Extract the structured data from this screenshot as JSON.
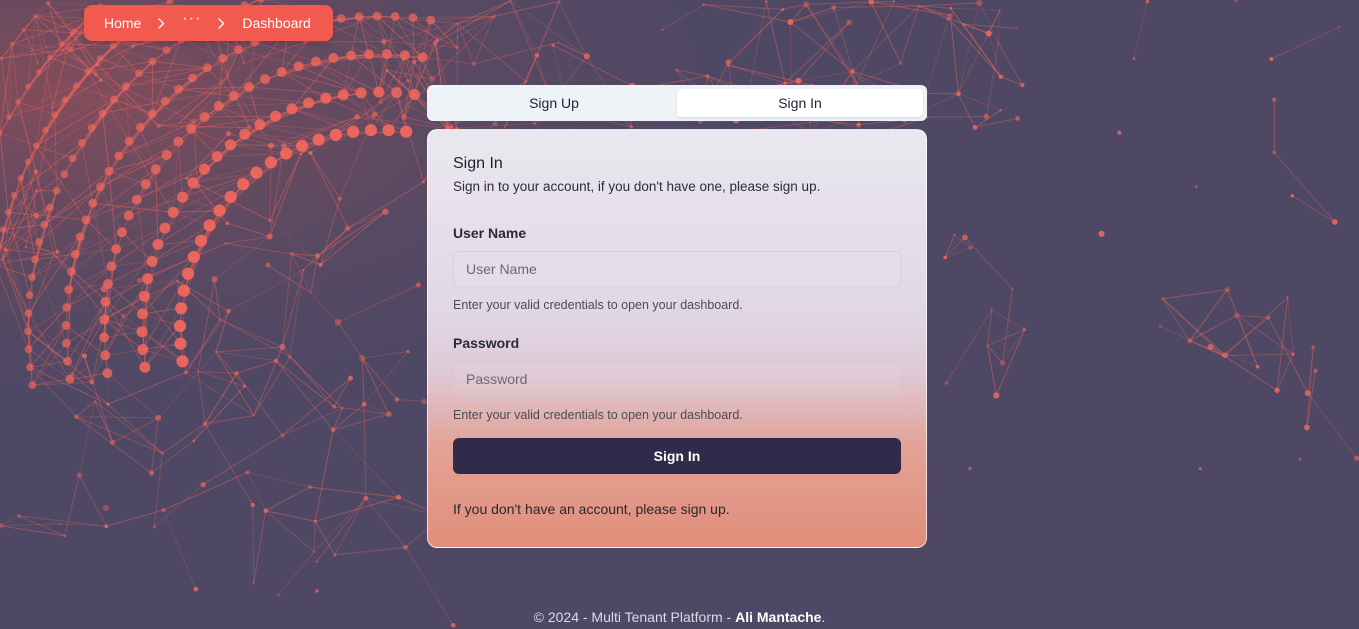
{
  "breadcrumb": {
    "home": "Home",
    "ellipsis": "···",
    "current": "Dashboard",
    "color": "#f2594f"
  },
  "tabs": {
    "sign_up": "Sign Up",
    "sign_in": "Sign In",
    "active": "sign_in"
  },
  "card": {
    "title": "Sign In",
    "subtitle": "Sign in to your account, if you don't have one, please sign up.",
    "username_label": "User Name",
    "username_placeholder": "User Name",
    "username_value": "",
    "username_hint": "Enter your valid credentials to open your dashboard.",
    "password_label": "Password",
    "password_placeholder": "Password",
    "password_value": "",
    "password_hint": "Enter your valid credentials to open your dashboard.",
    "submit_label": "Sign In",
    "signup_note": "If you don't have an account, please sign up."
  },
  "footer": {
    "prefix": "© 2024 - Multi Tenant Platform - ",
    "author": "Ali Mantache",
    "suffix": "."
  },
  "colors": {
    "background": "#4e4864",
    "network_accent": "#f2675c",
    "button": "#302a4b"
  },
  "icons": {
    "breadcrumb_separator": "chevron-right-icon"
  }
}
